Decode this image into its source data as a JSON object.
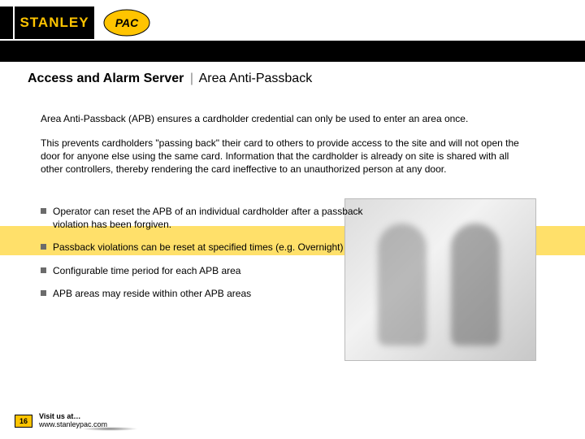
{
  "brand": {
    "stanley": "STANLEY",
    "pac": "PAC"
  },
  "title": {
    "main": "Access and Alarm Server",
    "sep": "|",
    "sub": "Area Anti-Passback"
  },
  "paragraphs": {
    "p1": "Area Anti-Passback (APB) ensures a cardholder credential can only be used to enter an area once.",
    "p2": "This prevents cardholders \"passing back\" their card to others to provide access to the site and will not open the door for anyone else using the same card. Information that the cardholder is already on site is shared with all other controllers, thereby rendering the card ineffective to an unauthorized person at any door."
  },
  "bullets": [
    "Operator can reset the APB of an individual cardholder after a passback violation has been forgiven.",
    "Passback violations can be reset at specified times (e.g. Overnight)",
    "Configurable time period for each APB area",
    "APB areas may reside within other APB areas"
  ],
  "footer": {
    "page": "16",
    "visit_label": "Visit us at…",
    "url": "www.stanleypac.com"
  },
  "colors": {
    "accent_yellow": "#ffc400",
    "band_yellow": "#ffe06a"
  }
}
